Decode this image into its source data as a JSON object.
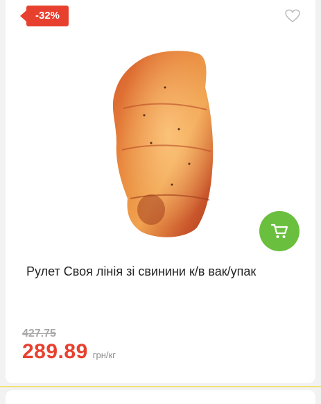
{
  "product": {
    "discount_badge": "-32%",
    "title": "Рулет Своя лінія зі свинини к/в вак/упак",
    "old_price": "427.75",
    "price": "289.89",
    "unit": "грн/кг",
    "image_icon": "product-photo-pork-roll",
    "favorite_icon": "heart-outline-icon",
    "cart_icon": "shopping-cart-icon"
  },
  "colors": {
    "discount": "#e8402f",
    "cart_button": "#6abf3e",
    "old_price": "#a9a9a9",
    "unit": "#8a8a8a"
  }
}
